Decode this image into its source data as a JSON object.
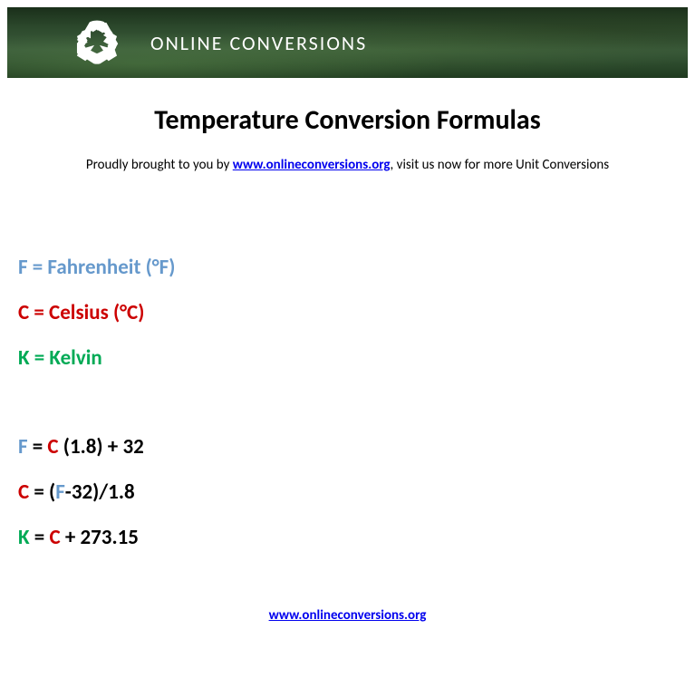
{
  "banner": {
    "icon_name": "recycle-icon",
    "title": "ONLINE CONVERSIONS"
  },
  "page": {
    "title": "Temperature Conversion Formulas",
    "subtitle_prefix": "Proudly brought to you by ",
    "subtitle_link": "www.onlineconversions.org",
    "subtitle_suffix": ", visit us now for more Unit Conversions"
  },
  "definitions": {
    "fahrenheit": {
      "letter": "F",
      "text": " = Fahrenheit (°F)"
    },
    "celsius": {
      "letter": "C",
      "text": " = Celsius (°C)"
    },
    "kelvin": {
      "letter": "K",
      "text": " = Kelvin"
    }
  },
  "formulas": {
    "f_formula": {
      "f": "F",
      "eq": " = ",
      "c": "C",
      "rest": " (1.8) + 32"
    },
    "c_formula": {
      "c": "C",
      "eq": " = (",
      "f": "F",
      "rest": "-32)/1.8"
    },
    "k_formula": {
      "k": "K",
      "eq": " = ",
      "c": "C",
      "rest": " + 273.15"
    }
  },
  "footer": {
    "link": "www.onlineconversions.org"
  }
}
